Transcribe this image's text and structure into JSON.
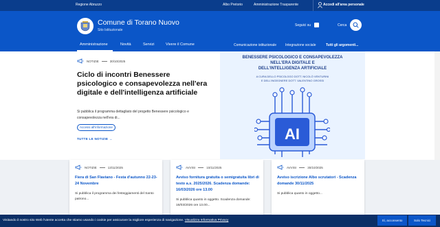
{
  "topbar": {
    "region": "Regione Abruzzo",
    "links": [
      "Albo Pretorio",
      "Amministrazione Trasparente"
    ],
    "login": "Accedi all'area personale"
  },
  "header": {
    "title": "Comune di Torano Nuovo",
    "subtitle": "Sito Istituzionale",
    "follow": "Seguici su",
    "search": "Cerca"
  },
  "nav": {
    "items": [
      "Amministrazione",
      "Novità",
      "Servizi",
      "Vivere il Comune"
    ],
    "secondary": [
      "Comunicazione istituzionale",
      "Integrazione sociale",
      "Tutti gli argomenti..."
    ]
  },
  "hero": {
    "category": "NOTIZIE",
    "date": "30/10/2025",
    "title": "Ciclo di incontri Benessere psicologico e consapevolezza nell'era digitale e dell'intelligenza artificiale",
    "description": "Si pubblica il programma dettagliato del progetto Benessere psicologico e consapevolezza nell'era di...",
    "tag": "Accessi all'informazione",
    "all_news": "TUTTE LE NOTIZIE",
    "image": {
      "line1": "BENESSERE PSICOLOGICO E CONSAPEVOLEZZA",
      "line2": "NELL'ERA DIGITALE E",
      "line3": "DELL'INTELLIGENZA ARTIFICIALE",
      "credit1": "A CURA DELLO PSICOLOGO DOTT. NICOLÒ VENTURINI",
      "credit2": "E DELL'INGEGNERE DOTT. VALENTINO GROSSI",
      "chip": "AI"
    }
  },
  "cards": [
    {
      "category": "NOTIZIE",
      "date": "13/11/2025",
      "title": "Fiera di San Flaviano - Festa d'autunno 22-23-24 Novembre",
      "description": "Si pubblica il programma dei festeggiamenti del Santo patrono..."
    },
    {
      "category": "AVVISI",
      "date": "10/11/2025",
      "title": "Avviso fornitura gratuita o semigratuita libri di testo a.s. 2025/2026. Scadenza domande: 16/03/2026 ore 13.00",
      "description": "Si pubblica quanto in oggetto. Scadenza domande: 16/03/2026 ore 13.00..."
    },
    {
      "category": "AVVISI",
      "date": "30/10/2025",
      "title": "Avviso iscrizione Albo scrutatori - Scadenza domande 30/11/2025",
      "description": "Si pubblica quanto in oggetto..."
    }
  ],
  "cookie": {
    "text": "Visitando il nostro sito Web l'utente accetta che stiamo usando i cookie per assicurare la migliore esperienza di navigazione.",
    "link": "Visualizza Informativa Privacy",
    "accept": "Sì, acconsento",
    "tech": "Solo Tecnici"
  },
  "colors": {
    "primary": "#0b56c8",
    "dark": "#0a3d8c",
    "cookie_bg": "#0b2f66"
  }
}
